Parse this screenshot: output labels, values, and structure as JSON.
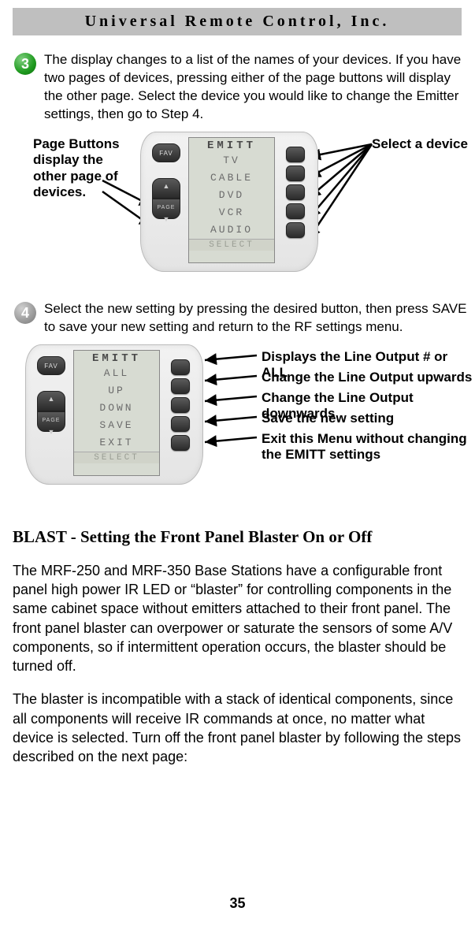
{
  "header": {
    "company": "Universal Remote Control, Inc."
  },
  "step3": {
    "num": "3",
    "text": "The display changes to a list of the names of your devices. If you have two pages of devices, pressing either of the page buttons will display the other page. Select the device you would like to change the Emitter settings, then go to Step 4."
  },
  "step4": {
    "num": "4",
    "text": "Select the new setting by pressing the desired button, then press SAVE to save your new setting and return to the RF settings menu."
  },
  "fig1": {
    "left_anno": "Page Buttons display the other page of devices.",
    "right_anno": "Select a device",
    "fav_label": "FAV",
    "page_label": "PAGE",
    "lcd_title": "EMITT",
    "rows": [
      "TV",
      "CABLE",
      "DVD",
      "VCR",
      "AUDIO"
    ],
    "select_label": "SELECT"
  },
  "fig2": {
    "fav_label": "FAV",
    "page_label": "PAGE",
    "lcd_title": "EMITT",
    "rows": [
      "ALL",
      "UP",
      "DOWN",
      "SAVE",
      "EXIT"
    ],
    "select_label": "SELECT",
    "annos": [
      "Displays the Line Output # or ALL",
      "Change the Line Output upwards",
      "Change the Line Output downwards",
      "Save the new setting",
      "Exit this Menu without changing the EMITT settings"
    ]
  },
  "section": {
    "heading": "BLAST - Setting the Front Panel Blaster On or Off",
    "p1": "The MRF-250 and MRF-350 Base Stations have a configurable front panel high power IR LED or “blaster” for controlling compo­nents in the same cabinet space without emitters attached to their front panel. The front panel blaster can overpower or saturate the sensors of some A/V components, so if intermittent operation occurs, the blaster should be turned off.",
    "p2": "The blaster is incompatible with a stack of identical components, since all components will receive IR commands at once, no mat­ter what device is selected. Turn off the front panel blaster by fol­lowing the steps described on the next page:"
  },
  "page_number": "35"
}
